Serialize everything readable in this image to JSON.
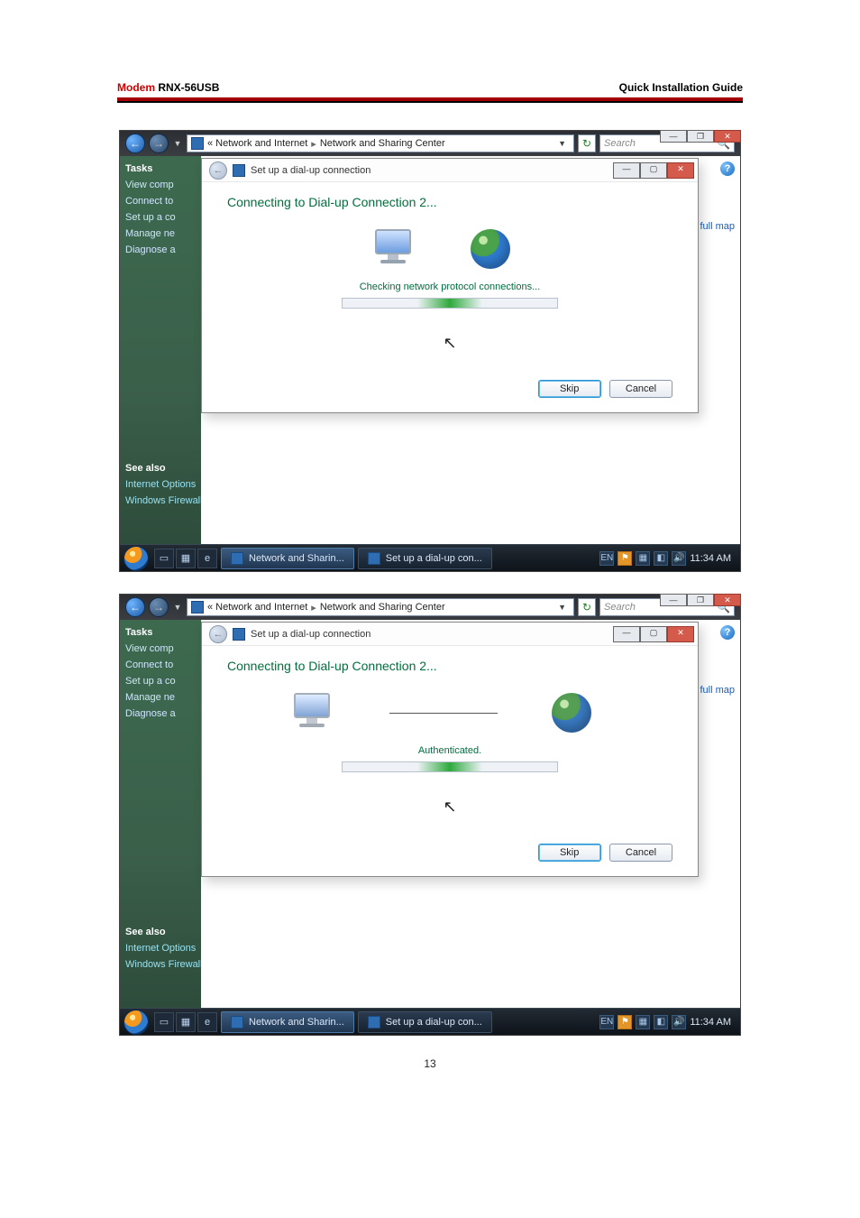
{
  "doc": {
    "brand": "Modem",
    "model": "RNX-56USB",
    "guide": "Quick  Installation  Guide",
    "pagenum": "13"
  },
  "shots": [
    {
      "addressbar": {
        "crumb1": "«  Network and Internet",
        "crumb2": "Network and Sharing Center",
        "search_placeholder": "Search"
      },
      "sidebar": {
        "tasks": "Tasks",
        "items": [
          "View comp",
          "Connect to",
          "Set up a co",
          "Manage ne",
          "Diagnose a"
        ],
        "seealso": "See also",
        "links": [
          "Internet Options",
          "Windows Firewall"
        ]
      },
      "right": {
        "help": "?",
        "viewmap": "iew full map"
      },
      "dialog": {
        "title": "Set up a dial-up connection",
        "heading": "Connecting to Dial-up Connection 2...",
        "status": "Checking network protocol connections...",
        "skip": "Skip",
        "cancel": "Cancel"
      },
      "taskbar": {
        "btn1": "Network and Sharin...",
        "btn2": "Set up a dial-up con...",
        "clock": "11:34 AM"
      }
    },
    {
      "addressbar": {
        "crumb1": "«  Network and Internet",
        "crumb2": "Network and Sharing Center",
        "search_placeholder": "Search"
      },
      "sidebar": {
        "tasks": "Tasks",
        "items": [
          "View comp",
          "Connect to",
          "Set up a co",
          "Manage ne",
          "Diagnose a"
        ],
        "seealso": "See also",
        "links": [
          "Internet Options",
          "Windows Firewall"
        ]
      },
      "right": {
        "help": "?",
        "viewmap": "iew full map"
      },
      "dialog": {
        "title": "Set up a dial-up connection",
        "heading": "Connecting to Dial-up Connection 2...",
        "status": "Authenticated.",
        "skip": "Skip",
        "cancel": "Cancel"
      },
      "taskbar": {
        "btn1": "Network and Sharin...",
        "btn2": "Set up a dial-up con...",
        "clock": "11:34 AM"
      }
    }
  ]
}
